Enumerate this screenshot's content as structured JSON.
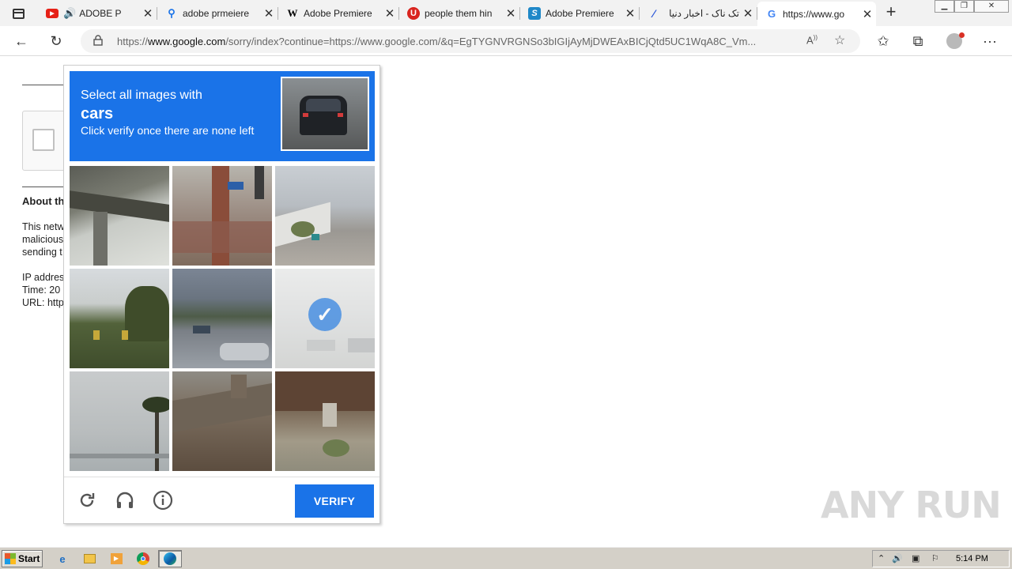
{
  "browser": {
    "tabs": [
      {
        "title": "ADOBE P",
        "favicon": "youtube-icon",
        "has_audio": true
      },
      {
        "title": "adobe prmeiere",
        "favicon": "search-icon"
      },
      {
        "title": "Adobe Premiere",
        "favicon": "wikipedia-icon"
      },
      {
        "title": "people them hin",
        "favicon": "ublock-icon"
      },
      {
        "title": "Adobe Premiere",
        "favicon": "app-store-icon"
      },
      {
        "title": "تک ناک - اخبار دنیا",
        "favicon": "feather-icon"
      },
      {
        "title": "https://www.go",
        "favicon": "google-icon",
        "active": true
      }
    ],
    "address": {
      "prefix": "https://",
      "domain": "www.google.com",
      "rest": "/sorry/index?continue=https://www.google.com/&q=EgTYGNVRGNSo3bIGIjAyMjDWEAxBICjQtd5UC1WqA8C_Vm..."
    }
  },
  "page": {
    "about_heading": "About th",
    "lines": [
      "This netw",
      "malicious",
      "sending t",
      "",
      "IP addres",
      "Time: 20",
      "URL: http"
    ]
  },
  "captcha": {
    "prompt_line1": "Select all images with",
    "prompt_target": "cars",
    "prompt_line3": "Click verify once there are none left",
    "verify_label": "VERIFY",
    "selected_tile": 6
  },
  "watermark": "ANY RUN",
  "taskbar": {
    "start_label": "Start",
    "clock": "5:14 PM"
  }
}
